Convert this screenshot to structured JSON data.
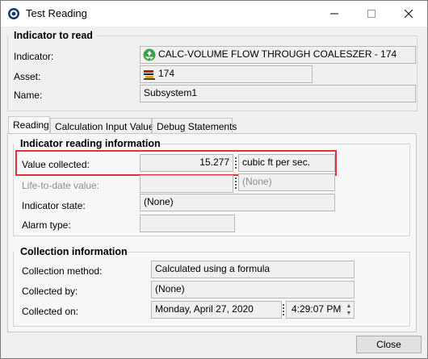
{
  "window": {
    "title": "Test Reading",
    "min_glyph": "—",
    "max_glyph": "☐",
    "close_glyph": "✕"
  },
  "indicator_section": {
    "title": "Indicator to read",
    "indicator_label": "Indicator:",
    "indicator_value": "CALC-VOLUME FLOW THROUGH COALESZER - 174",
    "indicator_icon": "recycle-icon",
    "asset_label": "Asset:",
    "asset_value": "174",
    "asset_icon": "equipment-icon",
    "name_label": "Name:",
    "name_value": "Subsystem1"
  },
  "tabs": [
    {
      "label": "Reading",
      "active": true
    },
    {
      "label": "Calculation Input Values",
      "active": false
    },
    {
      "label": "Debug Statements",
      "active": false
    }
  ],
  "reading_info": {
    "title": "Indicator reading information",
    "value_collected_label": "Value collected:",
    "value_collected": "15.277",
    "value_units": "cubic ft per sec.",
    "life_to_date_label": "Life-to-date value:",
    "life_to_date_value": "",
    "life_to_date_units": "(None)",
    "state_label": "Indicator state:",
    "state_value": "(None)",
    "alarm_label": "Alarm type:",
    "alarm_value": ""
  },
  "collection_info": {
    "title": "Collection information",
    "method_label": "Collection method:",
    "method_value": "Calculated using a formula",
    "by_label": "Collected by:",
    "by_value": "(None)",
    "on_label": "Collected on:",
    "date_value": "Monday, April 27, 2020",
    "time_value": "4:29:07 PM"
  },
  "footer": {
    "close_label": "Close"
  },
  "colors": {
    "highlight": "#e0333b"
  }
}
